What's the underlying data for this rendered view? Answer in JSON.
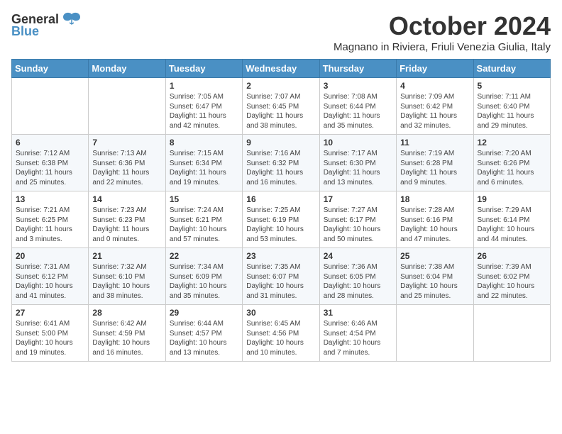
{
  "logo": {
    "general": "General",
    "blue": "Blue"
  },
  "header": {
    "title": "October 2024",
    "location": "Magnano in Riviera, Friuli Venezia Giulia, Italy"
  },
  "weekdays": [
    "Sunday",
    "Monday",
    "Tuesday",
    "Wednesday",
    "Thursday",
    "Friday",
    "Saturday"
  ],
  "weeks": [
    [
      null,
      null,
      {
        "day": "1",
        "sunrise": "Sunrise: 7:05 AM",
        "sunset": "Sunset: 6:47 PM",
        "daylight": "Daylight: 11 hours and 42 minutes."
      },
      {
        "day": "2",
        "sunrise": "Sunrise: 7:07 AM",
        "sunset": "Sunset: 6:45 PM",
        "daylight": "Daylight: 11 hours and 38 minutes."
      },
      {
        "day": "3",
        "sunrise": "Sunrise: 7:08 AM",
        "sunset": "Sunset: 6:44 PM",
        "daylight": "Daylight: 11 hours and 35 minutes."
      },
      {
        "day": "4",
        "sunrise": "Sunrise: 7:09 AM",
        "sunset": "Sunset: 6:42 PM",
        "daylight": "Daylight: 11 hours and 32 minutes."
      },
      {
        "day": "5",
        "sunrise": "Sunrise: 7:11 AM",
        "sunset": "Sunset: 6:40 PM",
        "daylight": "Daylight: 11 hours and 29 minutes."
      }
    ],
    [
      {
        "day": "6",
        "sunrise": "Sunrise: 7:12 AM",
        "sunset": "Sunset: 6:38 PM",
        "daylight": "Daylight: 11 hours and 25 minutes."
      },
      {
        "day": "7",
        "sunrise": "Sunrise: 7:13 AM",
        "sunset": "Sunset: 6:36 PM",
        "daylight": "Daylight: 11 hours and 22 minutes."
      },
      {
        "day": "8",
        "sunrise": "Sunrise: 7:15 AM",
        "sunset": "Sunset: 6:34 PM",
        "daylight": "Daylight: 11 hours and 19 minutes."
      },
      {
        "day": "9",
        "sunrise": "Sunrise: 7:16 AM",
        "sunset": "Sunset: 6:32 PM",
        "daylight": "Daylight: 11 hours and 16 minutes."
      },
      {
        "day": "10",
        "sunrise": "Sunrise: 7:17 AM",
        "sunset": "Sunset: 6:30 PM",
        "daylight": "Daylight: 11 hours and 13 minutes."
      },
      {
        "day": "11",
        "sunrise": "Sunrise: 7:19 AM",
        "sunset": "Sunset: 6:28 PM",
        "daylight": "Daylight: 11 hours and 9 minutes."
      },
      {
        "day": "12",
        "sunrise": "Sunrise: 7:20 AM",
        "sunset": "Sunset: 6:26 PM",
        "daylight": "Daylight: 11 hours and 6 minutes."
      }
    ],
    [
      {
        "day": "13",
        "sunrise": "Sunrise: 7:21 AM",
        "sunset": "Sunset: 6:25 PM",
        "daylight": "Daylight: 11 hours and 3 minutes."
      },
      {
        "day": "14",
        "sunrise": "Sunrise: 7:23 AM",
        "sunset": "Sunset: 6:23 PM",
        "daylight": "Daylight: 11 hours and 0 minutes."
      },
      {
        "day": "15",
        "sunrise": "Sunrise: 7:24 AM",
        "sunset": "Sunset: 6:21 PM",
        "daylight": "Daylight: 10 hours and 57 minutes."
      },
      {
        "day": "16",
        "sunrise": "Sunrise: 7:25 AM",
        "sunset": "Sunset: 6:19 PM",
        "daylight": "Daylight: 10 hours and 53 minutes."
      },
      {
        "day": "17",
        "sunrise": "Sunrise: 7:27 AM",
        "sunset": "Sunset: 6:17 PM",
        "daylight": "Daylight: 10 hours and 50 minutes."
      },
      {
        "day": "18",
        "sunrise": "Sunrise: 7:28 AM",
        "sunset": "Sunset: 6:16 PM",
        "daylight": "Daylight: 10 hours and 47 minutes."
      },
      {
        "day": "19",
        "sunrise": "Sunrise: 7:29 AM",
        "sunset": "Sunset: 6:14 PM",
        "daylight": "Daylight: 10 hours and 44 minutes."
      }
    ],
    [
      {
        "day": "20",
        "sunrise": "Sunrise: 7:31 AM",
        "sunset": "Sunset: 6:12 PM",
        "daylight": "Daylight: 10 hours and 41 minutes."
      },
      {
        "day": "21",
        "sunrise": "Sunrise: 7:32 AM",
        "sunset": "Sunset: 6:10 PM",
        "daylight": "Daylight: 10 hours and 38 minutes."
      },
      {
        "day": "22",
        "sunrise": "Sunrise: 7:34 AM",
        "sunset": "Sunset: 6:09 PM",
        "daylight": "Daylight: 10 hours and 35 minutes."
      },
      {
        "day": "23",
        "sunrise": "Sunrise: 7:35 AM",
        "sunset": "Sunset: 6:07 PM",
        "daylight": "Daylight: 10 hours and 31 minutes."
      },
      {
        "day": "24",
        "sunrise": "Sunrise: 7:36 AM",
        "sunset": "Sunset: 6:05 PM",
        "daylight": "Daylight: 10 hours and 28 minutes."
      },
      {
        "day": "25",
        "sunrise": "Sunrise: 7:38 AM",
        "sunset": "Sunset: 6:04 PM",
        "daylight": "Daylight: 10 hours and 25 minutes."
      },
      {
        "day": "26",
        "sunrise": "Sunrise: 7:39 AM",
        "sunset": "Sunset: 6:02 PM",
        "daylight": "Daylight: 10 hours and 22 minutes."
      }
    ],
    [
      {
        "day": "27",
        "sunrise": "Sunrise: 6:41 AM",
        "sunset": "Sunset: 5:00 PM",
        "daylight": "Daylight: 10 hours and 19 minutes."
      },
      {
        "day": "28",
        "sunrise": "Sunrise: 6:42 AM",
        "sunset": "Sunset: 4:59 PM",
        "daylight": "Daylight: 10 hours and 16 minutes."
      },
      {
        "day": "29",
        "sunrise": "Sunrise: 6:44 AM",
        "sunset": "Sunset: 4:57 PM",
        "daylight": "Daylight: 10 hours and 13 minutes."
      },
      {
        "day": "30",
        "sunrise": "Sunrise: 6:45 AM",
        "sunset": "Sunset: 4:56 PM",
        "daylight": "Daylight: 10 hours and 10 minutes."
      },
      {
        "day": "31",
        "sunrise": "Sunrise: 6:46 AM",
        "sunset": "Sunset: 4:54 PM",
        "daylight": "Daylight: 10 hours and 7 minutes."
      },
      null,
      null
    ]
  ]
}
